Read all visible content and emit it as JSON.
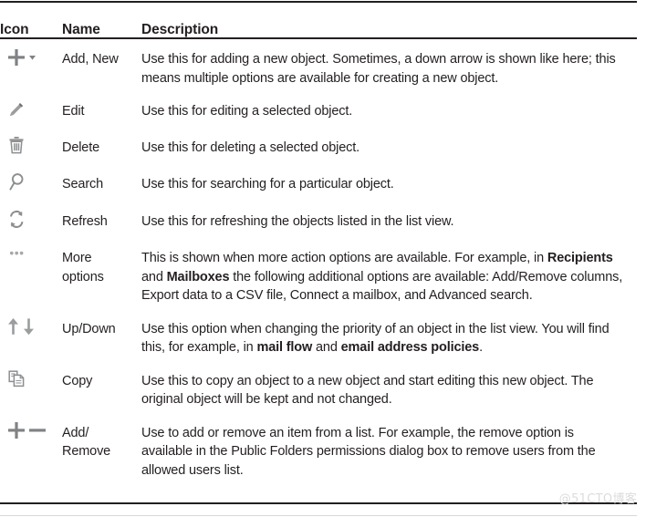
{
  "table": {
    "headers": {
      "icon": "Icon",
      "name": "Name",
      "description": "Description"
    },
    "rows": [
      {
        "icon_name": "add-new-icon",
        "name": "Add, New",
        "description": "Use this for adding a new object. Sometimes, a down arrow is shown like here; this means multiple options are available for creating a new object.",
        "description_bold": []
      },
      {
        "icon_name": "edit-pencil-icon",
        "name": "Edit",
        "description": "Use this for editing a selected object.",
        "description_bold": []
      },
      {
        "icon_name": "delete-trash-icon",
        "name": "Delete",
        "description": "Use this for deleting a selected object.",
        "description_bold": []
      },
      {
        "icon_name": "search-magnifier-icon",
        "name": "Search",
        "description": "Use this for searching for a particular object.",
        "description_bold": []
      },
      {
        "icon_name": "refresh-icon",
        "name": "Refresh",
        "description": "Use this for refreshing the objects listed in the list view.",
        "description_bold": []
      },
      {
        "icon_name": "more-options-ellipsis-icon",
        "name": "More\noptions",
        "description_parts": [
          {
            "text": "This is shown when more action options are available. For example, in ",
            "bold": false
          },
          {
            "text": "Recipients",
            "bold": true
          },
          {
            "text": " and ",
            "bold": false
          },
          {
            "text": "Mailboxes",
            "bold": true
          },
          {
            "text": " the following additional options are available: Add/Remove columns, Export data to a CSV file, Connect a mailbox, and Advanced search.",
            "bold": false
          }
        ]
      },
      {
        "icon_name": "up-down-arrows-icon",
        "name": "Up/Down",
        "description_parts": [
          {
            "text": "Use this option when changing the priority of an object in the list view. You will find this, for example, in ",
            "bold": false
          },
          {
            "text": "mail flow",
            "bold": true
          },
          {
            "text": " and ",
            "bold": false
          },
          {
            "text": "email address policies",
            "bold": true
          },
          {
            "text": ".",
            "bold": false
          }
        ]
      },
      {
        "icon_name": "copy-pages-icon",
        "name": "Copy",
        "description": "Use this to copy an object to a new object and start editing this new object. The original object will be kept and not changed.",
        "description_bold": []
      },
      {
        "icon_name": "add-remove-plus-minus-icon",
        "name": "Add/\nRemove",
        "description": "Use to add or remove an item from a list. For example, the remove option is available in the Public Folders permissions dialog box to remove users from the allowed users list.",
        "description_bold": []
      }
    ]
  },
  "watermark": {
    "text": "@51CTO博客"
  },
  "colors": {
    "text": "#231f20",
    "icon": "#808285",
    "rule": "#231f20",
    "watermark": "#dcdcdc",
    "background": "#ffffff"
  }
}
